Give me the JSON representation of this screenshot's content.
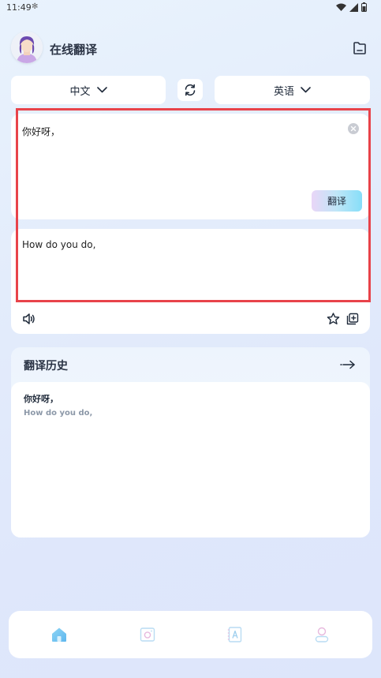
{
  "status_bar": {
    "time": "11:49"
  },
  "header": {
    "title": "在线翻译"
  },
  "language_bar": {
    "source": "中文",
    "target": "英语"
  },
  "input": {
    "text": "你好呀，",
    "translate_label": "翻译"
  },
  "output": {
    "text": "How do you do,"
  },
  "history": {
    "title": "翻译历史",
    "items": [
      {
        "source": "你好呀，",
        "translation": "How do you do,"
      }
    ]
  },
  "tabs": [
    {
      "icon": "home-icon",
      "active": true
    },
    {
      "icon": "camera-icon",
      "active": false
    },
    {
      "icon": "dictionary-icon",
      "active": false
    },
    {
      "icon": "profile-icon",
      "active": false
    }
  ],
  "colors": {
    "accent": "#5fc3ee",
    "highlight_border": "#e8434a",
    "tab_icon": "#b7dcf2"
  }
}
